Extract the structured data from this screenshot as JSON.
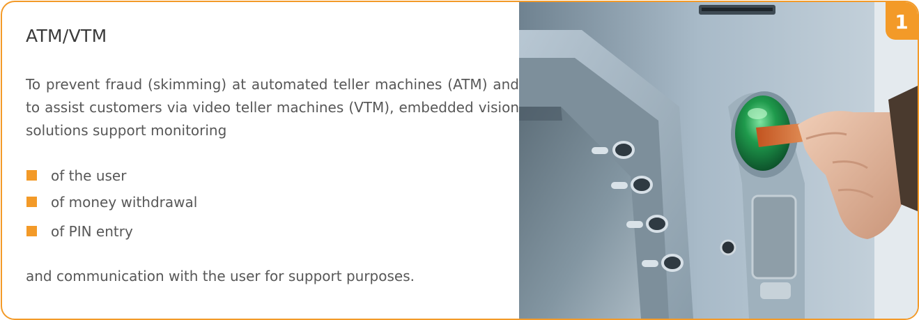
{
  "card": {
    "title": "ATM/VTM",
    "intro": "To prevent fraud (skimming) at automated teller machines (ATM) and to assist customers via video teller machines (VTM), embedded vision solutions support monitoring",
    "bullets": [
      "of the user",
      "of money withdrawal",
      "of PIN entry"
    ],
    "outro": "and communication with the user for support purposes.",
    "badge": "1"
  },
  "colors": {
    "accent": "#f39a28",
    "text": "#575757",
    "title": "#3a3a3a"
  },
  "photo": {
    "icon": "atm-card-insertion-photo"
  }
}
